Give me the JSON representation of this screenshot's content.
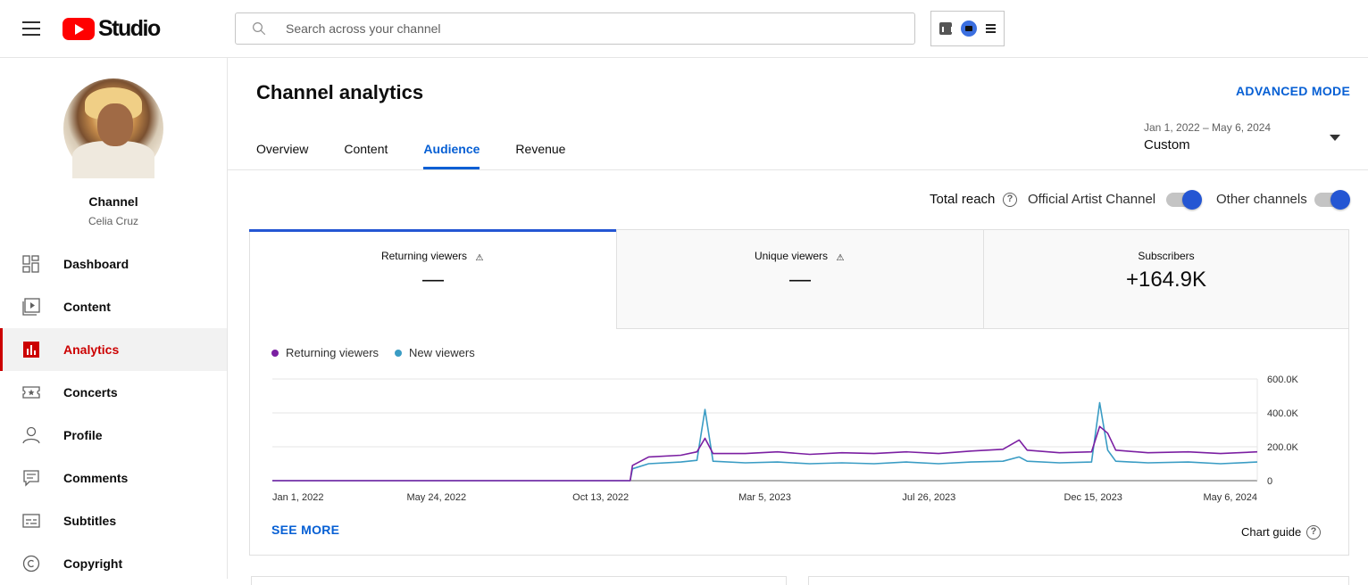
{
  "header": {
    "logo_text": "Studio",
    "search_placeholder": "Search across your channel"
  },
  "sidebar": {
    "channel_title": "Channel",
    "channel_name": "Celia Cruz",
    "items": [
      {
        "label": "Dashboard",
        "icon": "dashboard-icon"
      },
      {
        "label": "Content",
        "icon": "content-icon"
      },
      {
        "label": "Analytics",
        "icon": "analytics-icon",
        "active": true
      },
      {
        "label": "Concerts",
        "icon": "concerts-icon"
      },
      {
        "label": "Profile",
        "icon": "profile-icon"
      },
      {
        "label": "Comments",
        "icon": "comments-icon"
      },
      {
        "label": "Subtitles",
        "icon": "subtitles-icon"
      },
      {
        "label": "Copyright",
        "icon": "copyright-icon"
      }
    ]
  },
  "main": {
    "title": "Channel analytics",
    "advanced_mode": "ADVANCED MODE",
    "tabs": [
      {
        "label": "Overview"
      },
      {
        "label": "Content"
      },
      {
        "label": "Audience",
        "active": true
      },
      {
        "label": "Revenue"
      }
    ],
    "date_range": "Jan 1, 2022 – May 6, 2024",
    "date_mode": "Custom",
    "reach": {
      "label": "Total reach",
      "toggles": [
        {
          "label": "Official Artist Channel",
          "on": true
        },
        {
          "label": "Other channels",
          "on": true
        }
      ]
    },
    "metrics": [
      {
        "label": "Returning viewers",
        "value": "—",
        "warning": true,
        "active": true
      },
      {
        "label": "Unique viewers",
        "value": "—",
        "warning": true
      },
      {
        "label": "Subscribers",
        "value": "+164.9K",
        "warning": false
      }
    ],
    "see_more": "SEE MORE",
    "chart_guide": "Chart guide"
  },
  "colors": {
    "accent": "#065fd4",
    "active_nav": "#cc0000",
    "returning": "#7b1fa2",
    "new": "#3a9cc4"
  },
  "chart_data": {
    "type": "line",
    "x_tick_labels": [
      "Jan 1, 2022",
      "May 24, 2022",
      "Oct 13, 2022",
      "Mar 5, 2023",
      "Jul 26, 2023",
      "Dec 15, 2023",
      "May 6, 2024"
    ],
    "y_tick_labels": [
      "0",
      "200.0K",
      "400.0K",
      "600.0K"
    ],
    "ylim": [
      0,
      600000
    ],
    "x_start": "2022-01-01",
    "x_end": "2024-05-06",
    "legend_position": "top-left",
    "grid": true,
    "series": [
      {
        "name": "Returning viewers",
        "color": "#7b1fa2",
        "points": [
          [
            "2022-01-01",
            0
          ],
          [
            "2022-11-08",
            0
          ],
          [
            "2022-11-10",
            90000
          ],
          [
            "2022-11-24",
            140000
          ],
          [
            "2022-12-22",
            150000
          ],
          [
            "2023-01-05",
            170000
          ],
          [
            "2023-01-12",
            250000
          ],
          [
            "2023-01-19",
            160000
          ],
          [
            "2023-02-16",
            160000
          ],
          [
            "2023-03-16",
            170000
          ],
          [
            "2023-04-13",
            155000
          ],
          [
            "2023-05-11",
            165000
          ],
          [
            "2023-06-08",
            160000
          ],
          [
            "2023-07-06",
            170000
          ],
          [
            "2023-08-03",
            160000
          ],
          [
            "2023-08-31",
            175000
          ],
          [
            "2023-09-28",
            185000
          ],
          [
            "2023-10-12",
            240000
          ],
          [
            "2023-10-19",
            180000
          ],
          [
            "2023-11-16",
            165000
          ],
          [
            "2023-12-14",
            170000
          ],
          [
            "2023-12-21",
            320000
          ],
          [
            "2023-12-28",
            280000
          ],
          [
            "2024-01-04",
            180000
          ],
          [
            "2024-02-01",
            165000
          ],
          [
            "2024-03-07",
            170000
          ],
          [
            "2024-04-04",
            160000
          ],
          [
            "2024-05-06",
            170000
          ]
        ]
      },
      {
        "name": "New viewers",
        "color": "#3a9cc4",
        "points": [
          [
            "2022-01-01",
            0
          ],
          [
            "2022-11-08",
            0
          ],
          [
            "2022-11-10",
            70000
          ],
          [
            "2022-11-24",
            100000
          ],
          [
            "2022-12-22",
            110000
          ],
          [
            "2023-01-05",
            120000
          ],
          [
            "2023-01-12",
            420000
          ],
          [
            "2023-01-19",
            115000
          ],
          [
            "2023-02-16",
            105000
          ],
          [
            "2023-03-16",
            110000
          ],
          [
            "2023-04-13",
            100000
          ],
          [
            "2023-05-11",
            105000
          ],
          [
            "2023-06-08",
            100000
          ],
          [
            "2023-07-06",
            110000
          ],
          [
            "2023-08-03",
            100000
          ],
          [
            "2023-08-31",
            110000
          ],
          [
            "2023-09-28",
            115000
          ],
          [
            "2023-10-12",
            140000
          ],
          [
            "2023-10-19",
            115000
          ],
          [
            "2023-11-16",
            105000
          ],
          [
            "2023-12-14",
            110000
          ],
          [
            "2023-12-21",
            460000
          ],
          [
            "2023-12-28",
            180000
          ],
          [
            "2024-01-04",
            115000
          ],
          [
            "2024-02-01",
            105000
          ],
          [
            "2024-03-07",
            110000
          ],
          [
            "2024-04-04",
            100000
          ],
          [
            "2024-05-06",
            110000
          ]
        ]
      }
    ]
  }
}
